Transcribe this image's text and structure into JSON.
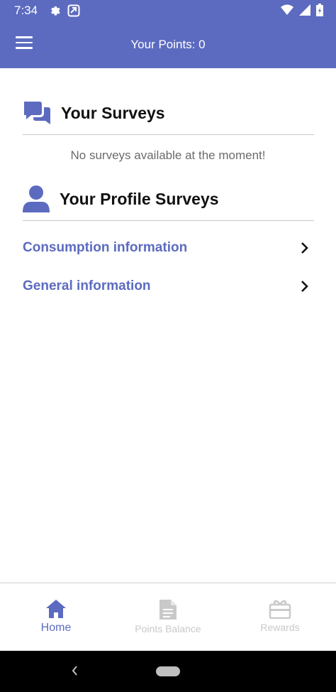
{
  "status_bar": {
    "time": "7:34",
    "icons": [
      "gear-icon",
      "notification-box-icon",
      "wifi-icon",
      "signal-icon",
      "battery-icon"
    ]
  },
  "app_bar": {
    "menu_icon": "hamburger-menu-icon",
    "points_label": "Your Points: 0",
    "color": "#5c6bc0"
  },
  "surveys_section": {
    "icon": "chat-bubbles-icon",
    "title": "Your Surveys",
    "empty_message": "No surveys available at the moment!"
  },
  "profile_section": {
    "icon": "person-icon",
    "title": "Your Profile Surveys",
    "items": [
      {
        "label": "Consumption information",
        "icon": "chevron-right-icon"
      },
      {
        "label": "General information",
        "icon": "chevron-right-icon"
      }
    ]
  },
  "bottom_nav": {
    "items": [
      {
        "label": "Home",
        "icon": "home-icon",
        "active": true
      },
      {
        "label": "Points Balance",
        "icon": "document-icon",
        "active": false
      },
      {
        "label": "Rewards",
        "icon": "gift-card-icon",
        "active": false
      }
    ],
    "active_color": "#5c6bc0",
    "inactive_color": "#c9c9c9"
  }
}
